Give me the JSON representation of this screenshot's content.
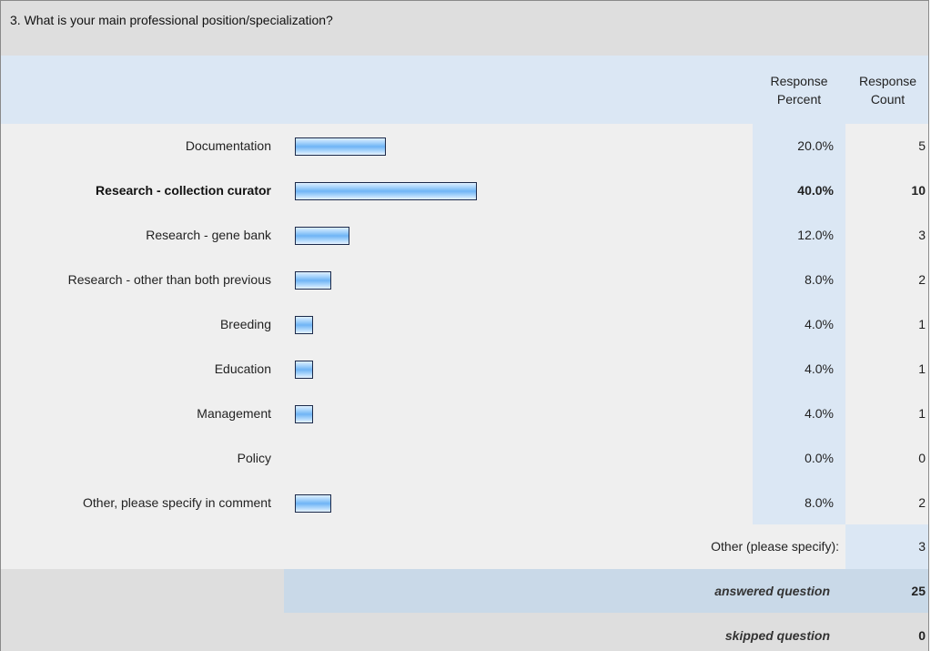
{
  "question": {
    "title": "3. What is your main professional position/specialization?"
  },
  "headers": {
    "percent_line1": "Response",
    "percent_line2": "Percent",
    "count_line1": "Response",
    "count_line2": "Count"
  },
  "chart_data": {
    "type": "bar",
    "orientation": "horizontal",
    "categories": [
      "Documentation",
      "Research - collection curator",
      "Research - gene bank",
      "Research - other than both previous",
      "Breeding",
      "Education",
      "Management",
      "Policy",
      "Other, please specify in comment"
    ],
    "percent_labels": [
      "20.0%",
      "40.0%",
      "12.0%",
      "8.0%",
      "4.0%",
      "4.0%",
      "4.0%",
      "0.0%",
      "8.0%"
    ],
    "values": [
      20.0,
      40.0,
      12.0,
      8.0,
      4.0,
      4.0,
      4.0,
      0.0,
      8.0
    ],
    "counts": [
      "5",
      "10",
      "3",
      "2",
      "1",
      "1",
      "1",
      "0",
      "2"
    ],
    "highlight_index": 1,
    "bar_color": "#6fb4f5"
  },
  "other_specify": {
    "label": "Other (please specify):",
    "count": "3"
  },
  "summary": {
    "answered_label": "answered question",
    "answered_value": "25",
    "skipped_label": "skipped question",
    "skipped_value": "0"
  }
}
